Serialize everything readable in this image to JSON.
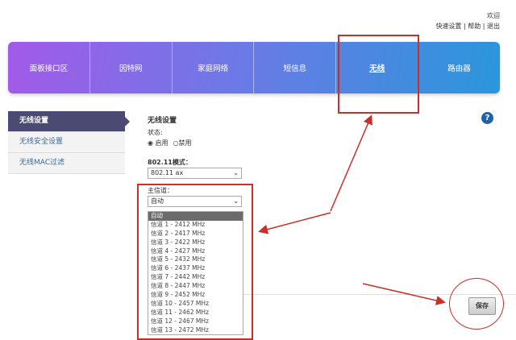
{
  "header": {
    "welcome": "欢迎",
    "links": [
      "快速设置",
      "帮助",
      "退出"
    ]
  },
  "nav": {
    "items": [
      "面板接口区",
      "因特网",
      "家庭网络",
      "短信息",
      "无线",
      "路由器"
    ],
    "active": 4
  },
  "sidebar": {
    "items": [
      "无线设置",
      "无线安全设置",
      "无线MAC过滤"
    ]
  },
  "main": {
    "title": "无线设置",
    "status_label": "状态:",
    "status_options": [
      "启用",
      "禁用"
    ],
    "mode_label": "802.11模式：",
    "mode_value": "802.11 ax",
    "channel_label": "主信道：",
    "channel_value": "自动",
    "channel_options": [
      "自动",
      "信道 1 - 2412 MHz",
      "信道 2 - 2417 MHz",
      "信道 3 - 2422 MHz",
      "信道 4 - 2427 MHz",
      "信道 5 - 2432 MHz",
      "信道 6 - 2437 MHz",
      "信道 7 - 2442 MHz",
      "信道 8 - 2447 MHz",
      "信道 9 - 2452 MHz",
      "信道 10 - 2457 MHz",
      "信道 11 - 2462 MHz",
      "信道 12 - 2467 MHz",
      "信道 13 - 2472 MHz"
    ],
    "help": "?",
    "save": "保存"
  },
  "colors": {
    "annotation": "#c8302a",
    "sidebar_active": "#4a4a72"
  }
}
